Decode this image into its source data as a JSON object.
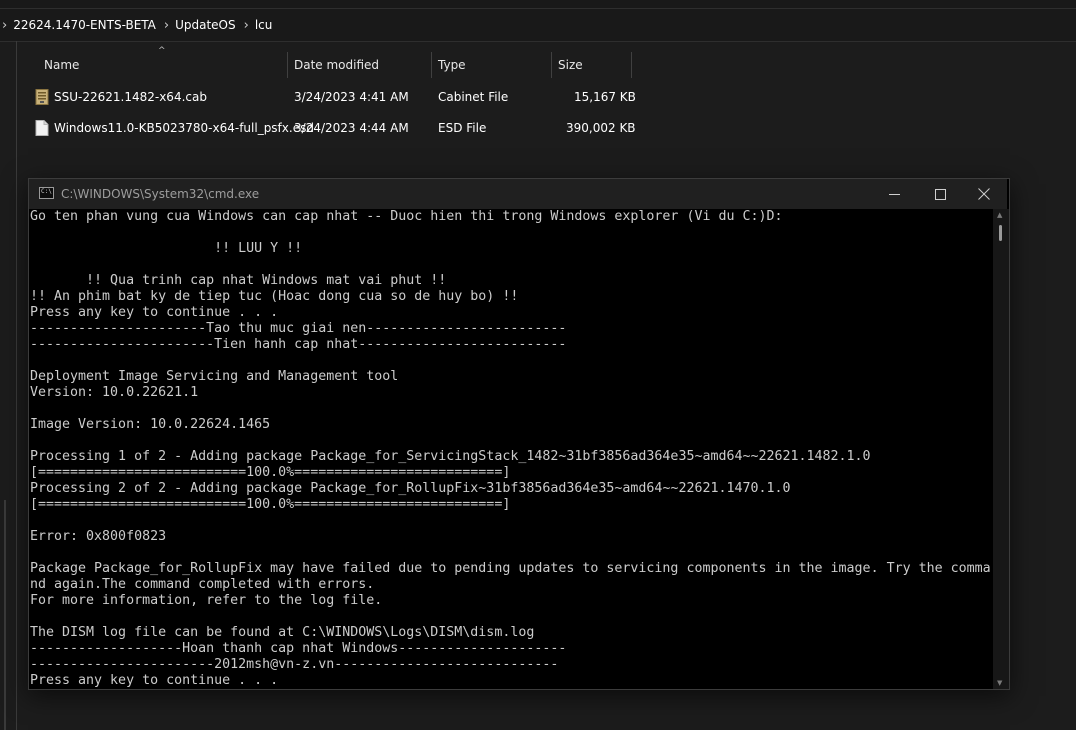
{
  "breadcrumb": {
    "items": [
      "22624.1470-ENTS-BETA",
      "UpdateOS",
      "lcu"
    ]
  },
  "file_list": {
    "columns": [
      "Name",
      "Date modified",
      "Type",
      "Size"
    ],
    "rows": [
      {
        "name": "SSU-22621.1482-x64.cab",
        "date": "3/24/2023 4:41 AM",
        "type": "Cabinet File",
        "size": "15,167 KB",
        "icon": "cabinet-file-icon"
      },
      {
        "name": "Windows11.0-KB5023780-x64-full_psfx.esd",
        "date": "3/24/2023 4:44 AM",
        "type": "ESD File",
        "size": "390,002 KB",
        "icon": "document-file-icon"
      }
    ]
  },
  "cmd_window": {
    "title": "C:\\WINDOWS\\System32\\cmd.exe",
    "lines": [
      "Go ten phan vung cua Windows can cap nhat -- Duoc hien thi trong Windows explorer (Vi du C:)D:",
      "",
      "                       !! LUU Y !!",
      "",
      "       !! Qua trinh cap nhat Windows mat vai phut !!",
      "!! An phim bat ky de tiep tuc (Hoac dong cua so de huy bo) !!",
      "Press any key to continue . . .",
      "----------------------Tao thu muc giai nen-------------------------",
      "-----------------------Tien hanh cap nhat--------------------------",
      "",
      "Deployment Image Servicing and Management tool",
      "Version: 10.0.22621.1",
      "",
      "Image Version: 10.0.22624.1465",
      "",
      "Processing 1 of 2 - Adding package Package_for_ServicingStack_1482~31bf3856ad364e35~amd64~~22621.1482.1.0",
      "[==========================100.0%==========================]",
      "Processing 2 of 2 - Adding package Package_for_RollupFix~31bf3856ad364e35~amd64~~22621.1470.1.0",
      "[==========================100.0%==========================]",
      "",
      "Error: 0x800f0823",
      "",
      "Package Package_for_RollupFix may have failed due to pending updates to servicing components in the image. Try the comma",
      "nd again.The command completed with errors.",
      "For more information, refer to the log file.",
      "",
      "The DISM log file can be found at C:\\WINDOWS\\Logs\\DISM\\dism.log",
      "-------------------Hoan thanh cap nhat Windows---------------------",
      "-----------------------2012msh@vn-z.vn----------------------------",
      "Press any key to continue . . ."
    ]
  }
}
